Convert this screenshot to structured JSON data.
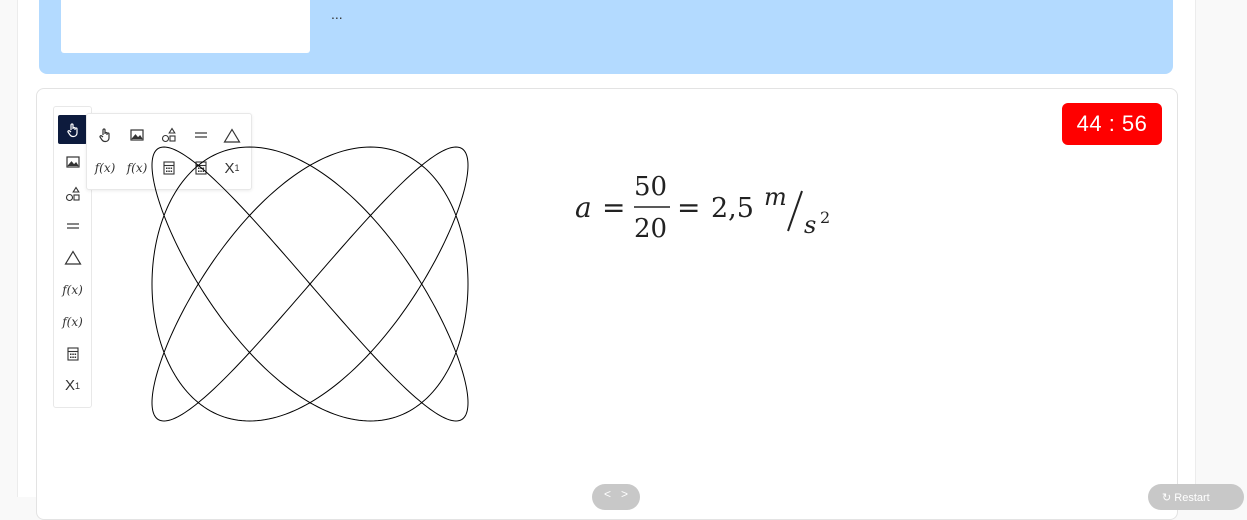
{
  "top_panel": {
    "text": "..."
  },
  "timer": {
    "text": "44 : 56",
    "color": "#ff0000"
  },
  "toolbar": {
    "items": [
      {
        "icon": "hand-pointer-icon",
        "active": true
      },
      {
        "icon": "image-icon"
      },
      {
        "icon": "shapes-icon"
      },
      {
        "icon": "equals-icon"
      },
      {
        "icon": "triangle-icon"
      },
      {
        "icon": "function-icon",
        "label": "f(x)"
      },
      {
        "icon": "function-icon",
        "label": "f(x)"
      },
      {
        "icon": "calculator-icon"
      },
      {
        "icon": "subscript-icon",
        "label": "X",
        "sub": "1"
      }
    ]
  },
  "tool_panel": {
    "row1": [
      "hand-pointer-icon",
      "image-icon",
      "shapes-icon",
      "equals-icon",
      "triangle-icon"
    ],
    "row2_labels": [
      "f(x)",
      "f(x)",
      "",
      "",
      "X"
    ],
    "sub": "1"
  },
  "formula": {
    "lhs": "a",
    "eq": "=",
    "numerator": "50",
    "denominator": "20",
    "result": "2,5",
    "unit_num": "m",
    "unit_den": "s",
    "unit_exp": "2"
  },
  "nav": {
    "prev": "<",
    "next": ">"
  },
  "restart": {
    "label": "Restart"
  },
  "colors": {
    "panel_blue": "#b3daff",
    "active_tool": "#0d1b3d"
  }
}
